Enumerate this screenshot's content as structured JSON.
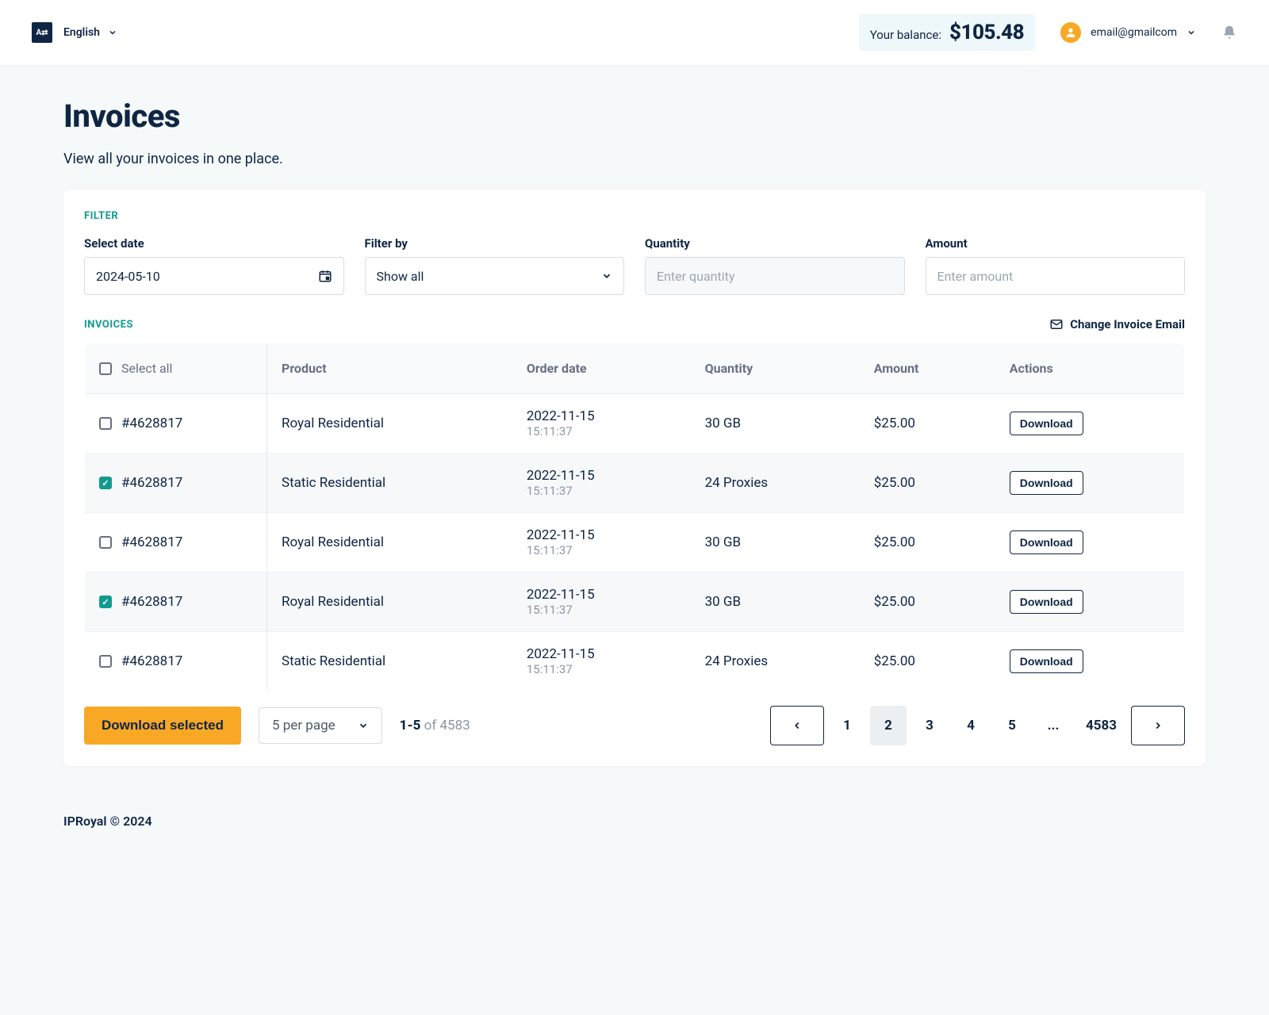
{
  "topbar": {
    "logo_text": "A⇄",
    "language": "English",
    "balance_label": "Your balance:",
    "balance_amount": "$105.48",
    "email": "email@gmailcom"
  },
  "page": {
    "title": "Invoices",
    "subtitle": "View all your invoices in one place."
  },
  "filters": {
    "section_label": "FILTER",
    "date_label": "Select date",
    "date_value": "2024-05-10",
    "filterby_label": "Filter by",
    "filterby_value": "Show all",
    "quantity_label": "Quantity",
    "quantity_placeholder": "Enter quantity",
    "amount_label": "Amount",
    "amount_placeholder": "Enter amount"
  },
  "invoices": {
    "section_label": "INVOICES",
    "change_email_label": "Change Invoice Email",
    "columns": {
      "select_all": "Select all",
      "product": "Product",
      "order_date": "Order date",
      "quantity": "Quantity",
      "amount": "Amount",
      "actions": "Actions"
    },
    "download_label": "Download",
    "rows": [
      {
        "id": "#4628817",
        "product": "Royal Residential",
        "date": "2022-11-15",
        "time": "15:11:37",
        "quantity": "30 GB",
        "amount": "$25.00",
        "checked": false
      },
      {
        "id": "#4628817",
        "product": "Static Residential",
        "date": "2022-11-15",
        "time": "15:11:37",
        "quantity": "24 Proxies",
        "amount": "$25.00",
        "checked": true
      },
      {
        "id": "#4628817",
        "product": "Royal Residential",
        "date": "2022-11-15",
        "time": "15:11:37",
        "quantity": "30 GB",
        "amount": "$25.00",
        "checked": false
      },
      {
        "id": "#4628817",
        "product": "Royal Residential",
        "date": "2022-11-15",
        "time": "15:11:37",
        "quantity": "30 GB",
        "amount": "$25.00",
        "checked": true
      },
      {
        "id": "#4628817",
        "product": "Static Residential",
        "date": "2022-11-15",
        "time": "15:11:37",
        "quantity": "24 Proxies",
        "amount": "$25.00",
        "checked": false
      }
    ]
  },
  "footer_actions": {
    "download_selected": "Download selected",
    "per_page": "5 per page",
    "range_bold": "1-5",
    "range_rest": " of 4583",
    "pages": [
      "1",
      "2",
      "3",
      "4",
      "5",
      "...",
      "4583"
    ],
    "active_page_index": 1
  },
  "footer": {
    "copyright": "IPRoyal © 2024"
  }
}
